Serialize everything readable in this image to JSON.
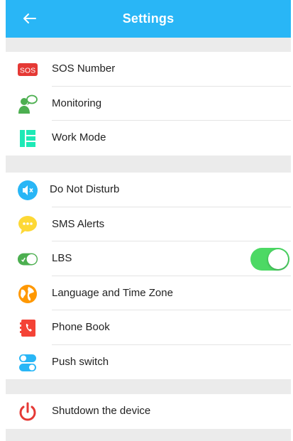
{
  "header": {
    "title": "Settings",
    "back_icon": "arrow-left-icon"
  },
  "colors": {
    "header": "#29b6f6",
    "sos": "#e53935",
    "toggle_on": "#4cd964"
  },
  "sections": [
    {
      "items": [
        {
          "label": "SOS Number",
          "icon": "sos-icon",
          "badge": "SOS"
        },
        {
          "label": "Monitoring",
          "icon": "monitoring-icon"
        },
        {
          "label": "Work Mode",
          "icon": "work-mode-icon"
        }
      ]
    },
    {
      "items": [
        {
          "label": "Do Not Disturb",
          "icon": "mute-icon"
        },
        {
          "label": "SMS Alerts",
          "icon": "message-icon"
        },
        {
          "label": "LBS",
          "icon": "lbs-toggle-icon",
          "toggle": true,
          "toggle_on": true
        },
        {
          "label": "Language and Time Zone",
          "icon": "globe-icon"
        },
        {
          "label": "Phone Book",
          "icon": "phone-book-icon"
        },
        {
          "label": "Push switch",
          "icon": "push-switch-icon"
        }
      ]
    },
    {
      "items": [
        {
          "label": "Shutdown the device",
          "icon": "power-icon"
        }
      ]
    }
  ]
}
